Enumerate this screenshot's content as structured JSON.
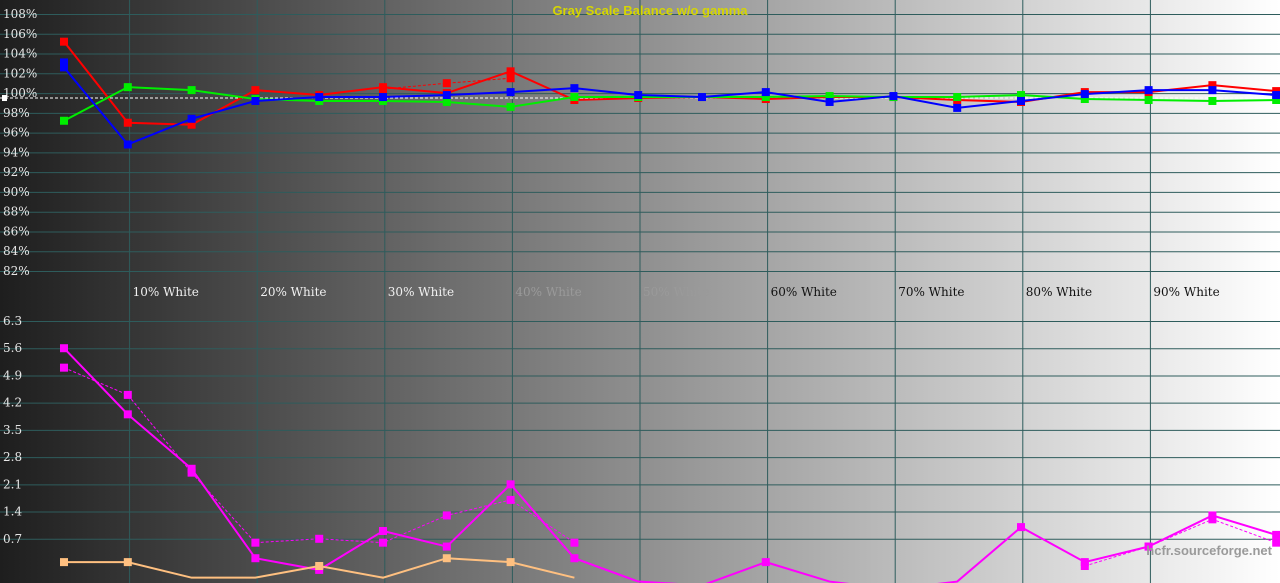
{
  "chart_data": [
    {
      "type": "line",
      "title": "Gray Scale Balance w/o gamma",
      "categories": [
        "",
        "10% White",
        "20% White",
        "30% White",
        "40% White",
        "50% White",
        "60% White",
        "70% White",
        "80% White",
        "90% White",
        ""
      ],
      "yticks": [
        "108%",
        "106%",
        "104%",
        "102%",
        "100%",
        "98%",
        "96%",
        "94%",
        "92%",
        "90%",
        "88%",
        "86%",
        "84%",
        "82%"
      ],
      "ylim": [
        82,
        108
      ],
      "reference_line": 99.5,
      "series": [
        {
          "color": "#ff0000",
          "values": [
            105.2,
            97.0,
            96.8,
            100.3,
            99.8,
            100.6,
            100.0,
            102.2,
            99.3,
            99.5,
            99.6,
            99.4,
            99.6,
            99.6,
            99.3,
            99.1,
            100.1,
            100.1,
            100.8,
            100.2,
            100.2
          ],
          "ref_values": [
            null,
            null,
            null,
            null,
            null,
            100.4,
            101.0,
            101.5,
            null,
            null,
            null,
            null,
            null,
            null,
            null,
            null,
            null,
            null,
            null,
            null,
            null
          ]
        },
        {
          "color": "#00ee00",
          "values": [
            97.2,
            100.6,
            100.3,
            99.4,
            99.2,
            99.2,
            99.1,
            98.6,
            99.6,
            99.6,
            99.6,
            99.6,
            99.7,
            99.6,
            99.6,
            99.8,
            99.4,
            99.3,
            99.2,
            99.3,
            99.3
          ],
          "ref_values": []
        },
        {
          "color": "#0000ff",
          "values": [
            102.6,
            94.8,
            97.4,
            99.2,
            99.6,
            99.6,
            99.8,
            100.1,
            100.5,
            99.8,
            99.6,
            100.1,
            99.1,
            99.7,
            98.5,
            99.2,
            99.9,
            100.3,
            100.3,
            99.8,
            100.2
          ],
          "ref_values": [
            103.1,
            null,
            null,
            null,
            null,
            null,
            null,
            null,
            null,
            null,
            null,
            null,
            null,
            null,
            null,
            null,
            null,
            null,
            null,
            null,
            null
          ]
        }
      ]
    },
    {
      "type": "line",
      "yticks": [
        "6.3",
        "5.6",
        "4.9",
        "4.2",
        "3.5",
        "2.8",
        "2.1",
        "1.4",
        "0.7"
      ],
      "ylim": [
        0,
        6.3
      ],
      "series": [
        {
          "color": "#ff00ff",
          "values": [
            5.6,
            3.9,
            2.5,
            0.2,
            -0.1,
            0.9,
            0.5,
            2.1,
            0.2,
            -0.4,
            -0.5,
            0.1,
            -0.4,
            -0.6,
            -0.4,
            1.0,
            0.1,
            0.5,
            1.3,
            0.8,
            0.8
          ],
          "ref_values": [
            5.1,
            4.4,
            2.4,
            0.6,
            0.7,
            0.6,
            1.3,
            1.7,
            0.6,
            null,
            null,
            null,
            null,
            null,
            null,
            null,
            0.0,
            0.5,
            1.2,
            0.6,
            0.8
          ]
        },
        {
          "color": "#ffc080",
          "values": [
            0.1,
            0.1,
            -0.3,
            -0.3,
            0.0,
            -0.3,
            0.2,
            0.1,
            -0.3,
            null,
            null,
            null,
            null,
            null,
            null,
            null,
            null,
            null,
            null,
            null,
            null
          ],
          "ref_values": []
        }
      ]
    }
  ],
  "watermark": "hcfr.sourceforge.net"
}
